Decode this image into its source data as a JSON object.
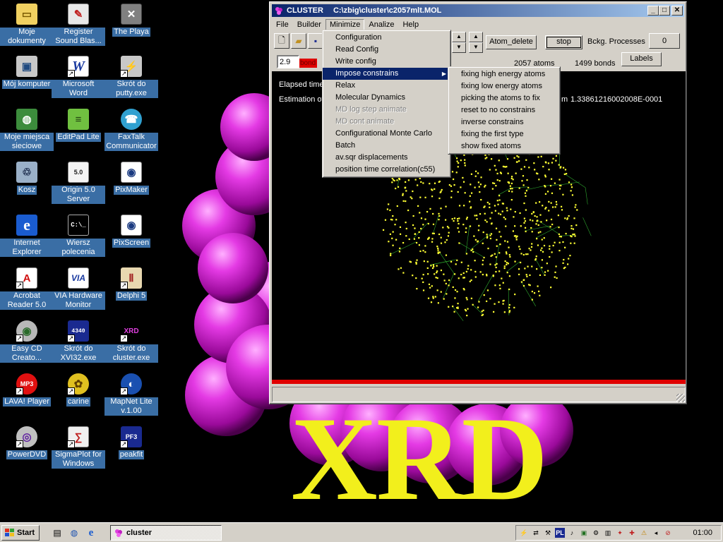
{
  "desktop": {
    "icons": [
      {
        "label": "Moje dokumenty",
        "icon": "folder-icon"
      },
      {
        "label": "Register Sound Blas...",
        "icon": "register-icon"
      },
      {
        "label": "The Playa",
        "icon": "playa-icon"
      },
      {
        "label": "Mój komputer",
        "icon": "computer-icon"
      },
      {
        "label": "Microsoft Word",
        "icon": "word-icon"
      },
      {
        "label": "Skrót do putty.exe",
        "icon": "putty-icon"
      },
      {
        "label": "Moje miejsca sieciowe",
        "icon": "network-icon"
      },
      {
        "label": "EditPad Lite",
        "icon": "editpad-icon"
      },
      {
        "label": "FaxTalk Communicator",
        "icon": "faxtalk-icon"
      },
      {
        "label": "Kosz",
        "icon": "recycle-bin-icon"
      },
      {
        "label": "Origin 5.0 Server",
        "icon": "origin-icon"
      },
      {
        "label": "PixMaker",
        "icon": "pixmaker-icon"
      },
      {
        "label": "Internet Explorer",
        "icon": "ie-icon"
      },
      {
        "label": "Wiersz polecenia",
        "icon": "cmd-icon"
      },
      {
        "label": "PixScreen",
        "icon": "pixscreen-icon"
      },
      {
        "label": "Acrobat Reader 5.0",
        "icon": "acrobat-icon"
      },
      {
        "label": "VIA Hardware Monitor",
        "icon": "via-icon"
      },
      {
        "label": "Delphi 5",
        "icon": "delphi-icon"
      },
      {
        "label": "Easy CD Creato...",
        "icon": "cd-icon"
      },
      {
        "label": "Skrót do XVI32.exe",
        "icon": "hex-icon"
      },
      {
        "label": "Skrót do cluster.exe",
        "icon": "cluster-icon"
      },
      {
        "label": "LAVA! Player",
        "icon": "lava-icon"
      },
      {
        "label": "carine",
        "icon": "carine-icon"
      },
      {
        "label": "MapNet Lite v.1.00",
        "icon": "mapnet-icon"
      },
      {
        "label": "PowerDVD",
        "icon": "dvd-icon"
      },
      {
        "label": "SigmaPlot for Windows",
        "icon": "sigmaplot-icon"
      },
      {
        "label": "peakfit",
        "icon": "peakfit-icon"
      }
    ],
    "wallpaper_text": "XRD"
  },
  "window": {
    "app_name": "CLUSTER",
    "file_path": "C:\\zbig\\cluster\\c2057mlt.MOL",
    "menubar": [
      "File",
      "Builder",
      "Minimize",
      "Analize",
      "Help"
    ],
    "bond_value": "2.9",
    "bond_label": "bond",
    "atom_delete": "Atom_delete",
    "stop": "stop",
    "bckg_processes_label": "Bckg. Processes",
    "bckg_processes_value": "0",
    "labels_button": "Labels",
    "atoms_count": "2057 atoms",
    "bonds_count": "1499 bonds",
    "elapsed_label": "Elapsed time",
    "estimation_label": "Estimation of",
    "estimation_tail": "m",
    "estimation_value": "1.33861216002008E-0001"
  },
  "minimize_menu": {
    "items": [
      {
        "label": "Configuration",
        "enabled": true
      },
      {
        "label": "Read Config",
        "enabled": true
      },
      {
        "label": "Write config",
        "enabled": true
      },
      {
        "label": "Impose constrains",
        "enabled": true,
        "highlighted": true,
        "submenu": true
      },
      {
        "label": "Relax",
        "enabled": true
      },
      {
        "label": "Molecular Dynamics",
        "enabled": true
      },
      {
        "label": "MD log step animate",
        "enabled": false
      },
      {
        "label": "MD cont animate",
        "enabled": false
      },
      {
        "label": "Configurational Monte Carlo",
        "enabled": true
      },
      {
        "label": "Batch",
        "enabled": true
      },
      {
        "label": "av.sqr displacements",
        "enabled": true
      },
      {
        "label": "position time correlation(c55)",
        "enabled": true
      }
    ]
  },
  "constrains_submenu": {
    "items": [
      "fixing high energy atoms",
      "fixing low energy atoms",
      "picking the atoms to fix",
      "reset to no constrains",
      "inverse constrains",
      "fixing the first type",
      "show fixed atoms"
    ]
  },
  "taskbar": {
    "start_label": "Start",
    "task_label": "cluster",
    "tray_lang": "PL",
    "clock": "01:00"
  },
  "colors": {
    "desktop_label_bg": "#3a6ea5",
    "titlebar": "#0a246a",
    "atom_color": "#ffff33",
    "bond_color": "#2ea82e",
    "sphere_color": "#e020e0",
    "wallpaper_text": "#f2ef1c"
  }
}
